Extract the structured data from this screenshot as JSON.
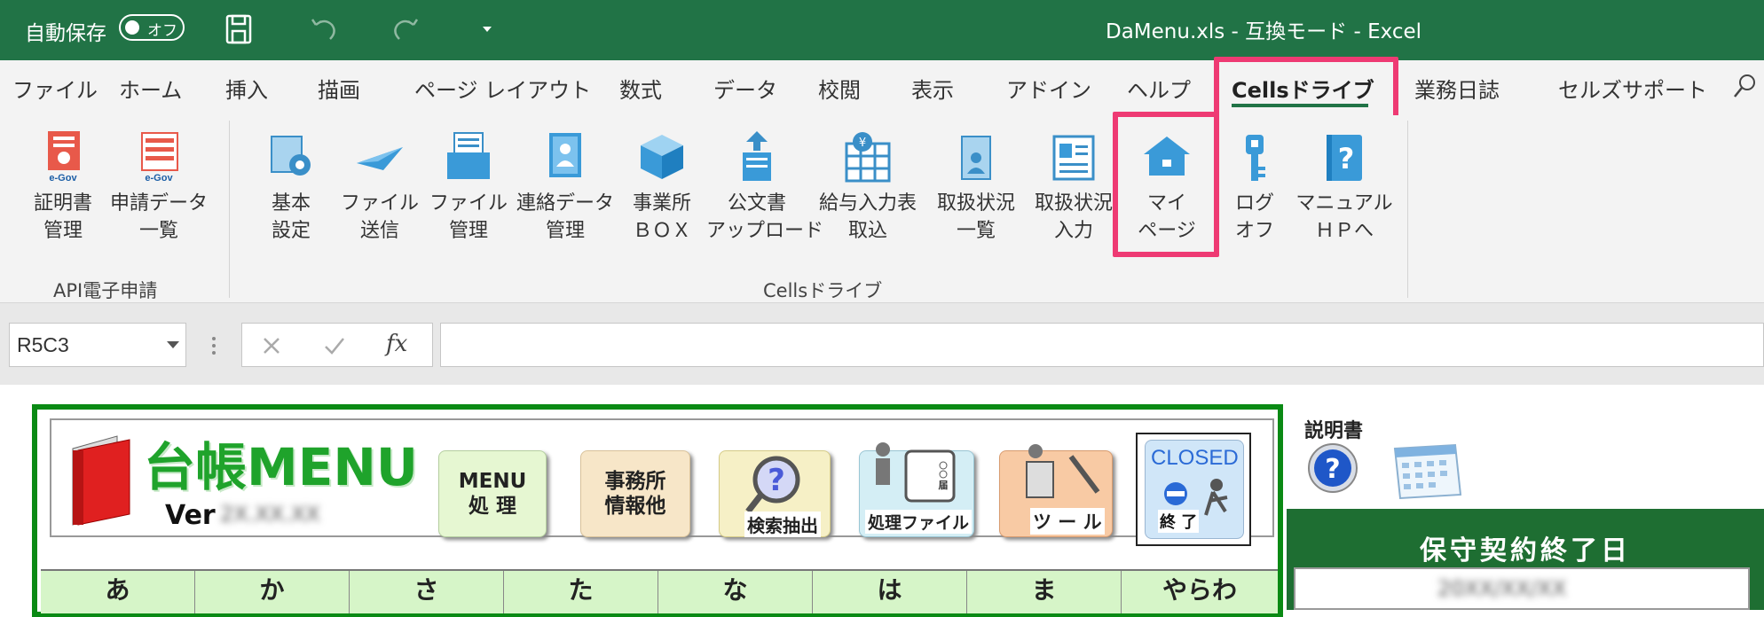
{
  "titlebar": {
    "autosave_label": "自動保存",
    "autosave_state": "オフ",
    "title": "DaMenu.xls  -  互換モード  -  Excel"
  },
  "tabs": [
    "ファイル",
    "ホーム",
    "挿入",
    "描画",
    "ページ レイアウト",
    "数式",
    "データ",
    "校閲",
    "表示",
    "アドイン",
    "ヘルプ",
    "Cellsドライブ",
    "業務日誌",
    "セルズサポート"
  ],
  "ribbon": {
    "group1": {
      "name": "API電子申請",
      "buttons": [
        {
          "l1": "証明書",
          "l2": "管理"
        },
        {
          "l1": "申請データ",
          "l2": "一覧"
        }
      ]
    },
    "group2": {
      "name": "Cellsドライブ",
      "buttons": [
        {
          "l1": "基本",
          "l2": "設定"
        },
        {
          "l1": "ファイル",
          "l2": "送信"
        },
        {
          "l1": "ファイル",
          "l2": "管理"
        },
        {
          "l1": "連絡データ",
          "l2": "管理"
        },
        {
          "l1": "事業所",
          "l2": "ＢＯＸ"
        },
        {
          "l1": "公文書",
          "l2": "アップロード"
        },
        {
          "l1": "給与入力表",
          "l2": "取込"
        },
        {
          "l1": "取扱状況",
          "l2": "一覧"
        },
        {
          "l1": "取扱状況",
          "l2": "入力"
        },
        {
          "l1": "マイ",
          "l2": "ページ"
        },
        {
          "l1": "ログ",
          "l2": "オフ"
        },
        {
          "l1": "マニュアル",
          "l2": "ＨＰへ"
        }
      ]
    },
    "egov": "e-Gov"
  },
  "formula": {
    "namebox": "R5C3",
    "fx": "fx"
  },
  "sheet": {
    "app_title": "台帳MENU",
    "ver_label": "Ver",
    "ver_value": "2X.XX.XX",
    "buttons": {
      "menu": "MENU\n処 理",
      "office": "事務所\n情報他",
      "search": "検索抽出",
      "files": "処理ファイル",
      "tool": "ツ ー ル",
      "closed": "CLOSED",
      "end": "終 了",
      "todoke": "届"
    },
    "manual_label": "説明書",
    "maint_title": "保守契約終了日",
    "maint_value": "20XX/XX/XX",
    "kana": [
      "あ",
      "か",
      "さ",
      "た",
      "な",
      "は",
      "ま",
      "やらわ"
    ]
  }
}
